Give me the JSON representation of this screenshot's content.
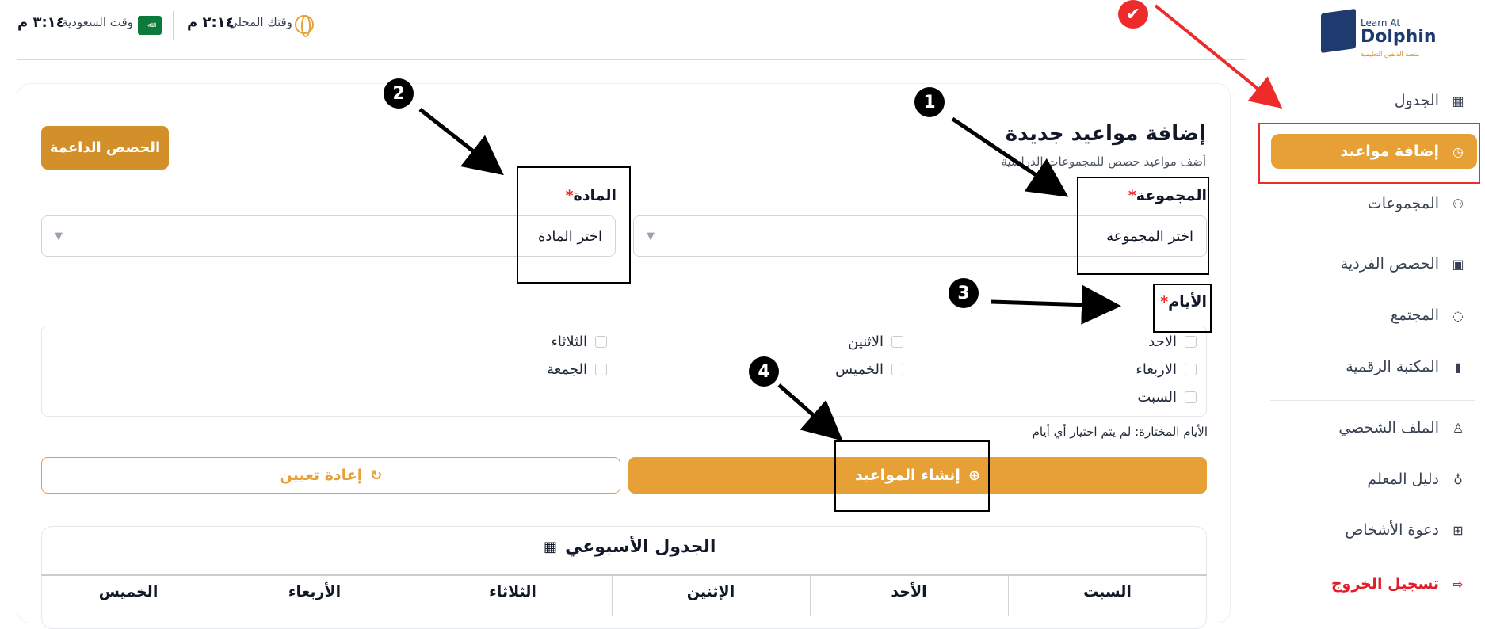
{
  "header": {
    "saudi_label": "وقت السعودية",
    "saudi_time": "٣:١٤ م",
    "local_label": "وقتك المحلي",
    "local_time": "٢:١٤ م",
    "flag_text": "ﷲ"
  },
  "logo": {
    "line1": "Learn At",
    "line2": "Dolphin",
    "line3": "منصة الدلفين التعليمية"
  },
  "sidebar": {
    "items": [
      {
        "label": "الجدول",
        "icon": "calendar-icon"
      },
      {
        "label": "إضافة مواعيد",
        "icon": "clock-icon"
      },
      {
        "label": "المجموعات",
        "icon": "users-icon"
      },
      {
        "label": "الحصص الفردية",
        "icon": "user-screen-icon"
      },
      {
        "label": "المجتمع",
        "icon": "chat-icon"
      },
      {
        "label": "المكتبة الرقمية",
        "icon": "book-icon"
      },
      {
        "label": "الملف الشخصي",
        "icon": "user-icon"
      },
      {
        "label": "دليل المعلم",
        "icon": "bulb-icon"
      },
      {
        "label": "دعوة الأشخاص",
        "icon": "gift-icon"
      },
      {
        "label": "تسجيل الخروج",
        "icon": "logout-icon"
      }
    ]
  },
  "main": {
    "title": "إضافة مواعيد جديدة",
    "subtitle": "أضف مواعيد حصص للمجموعات الدراسية",
    "support_button": "الحصص الداعمة",
    "group_label": "المجموعة",
    "group_placeholder": "اختر المجموعة",
    "subject_label": "المادة",
    "subject_placeholder": "اختر المادة",
    "required_mark": "*",
    "days_label": "الأيام",
    "days": [
      "الاحد",
      "الاثنين",
      "الثلاثاء",
      "الاربعاء",
      "الخميس",
      "الجمعة",
      "السبت"
    ],
    "selected_days_text": "الأيام المختارة: لم يتم اختيار أي أيام",
    "create_button": "إنشاء المواعيد",
    "reset_button": "إعادة تعيين",
    "weekly_title": "الجدول الأسبوعي",
    "table_headers": [
      "السبت",
      "الأحد",
      "الإثنين",
      "الثلاثاء",
      "الأربعاء",
      "الخميس"
    ]
  },
  "annotations": {
    "steps": [
      "1",
      "2",
      "3",
      "4"
    ]
  },
  "colors": {
    "accent": "#e6a035",
    "danger": "#ee2b2b",
    "brand": "#1e3a6e"
  }
}
